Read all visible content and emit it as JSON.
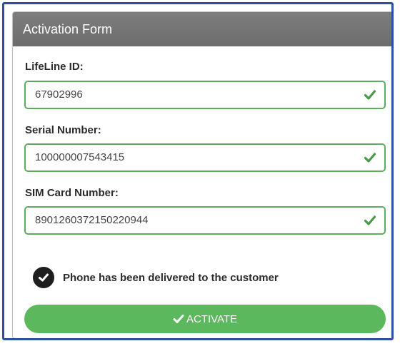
{
  "header": {
    "title": "Activation Form"
  },
  "fields": [
    {
      "label": "LifeLine ID:",
      "value": "67902996",
      "valid": true
    },
    {
      "label": "Serial Number:",
      "value": "100000007543415",
      "valid": true
    },
    {
      "label": "SIM Card Number:",
      "value": "8901260372150220944",
      "valid": true
    }
  ],
  "confirmation": {
    "checked": true,
    "label": "Phone has been delivered to the customer"
  },
  "activate_button": {
    "label": "ACTIVATE",
    "icon": "check-icon"
  },
  "colors": {
    "header_bg": "#737373",
    "valid_border": "#5cae5c",
    "valid_check": "#4a9a4a",
    "button_bg": "#5cb85c",
    "frame_border": "#2f4fa6"
  }
}
